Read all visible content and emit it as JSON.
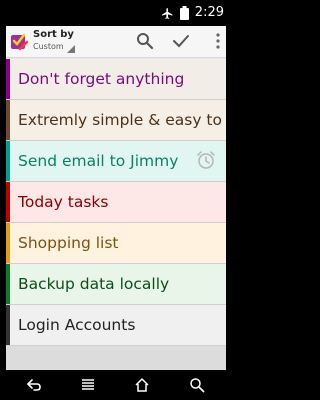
{
  "status_bar": {
    "time": "2:29",
    "icons": [
      "airplane-mode-icon",
      "battery-icon"
    ]
  },
  "action_bar": {
    "sort_title": "Sort by",
    "sort_value": "Custom",
    "actions": [
      "search-icon",
      "check-icon",
      "overflow-menu-icon"
    ]
  },
  "tasks": [
    {
      "label": "Don't forget anything",
      "stripe_color": "#8b008b",
      "bg_color": "#f2ede6",
      "text_color": "#7a0a7a",
      "has_alarm": false
    },
    {
      "label": "Extremly simple & easy to use",
      "stripe_color": "#6b4a2e",
      "bg_color": "#f6efe6",
      "text_color": "#4a3318",
      "has_alarm": false
    },
    {
      "label": "Send email to Jimmy",
      "stripe_color": "#00a38a",
      "bg_color": "#e2f6f1",
      "text_color": "#0a7f6a",
      "has_alarm": true
    },
    {
      "label": "Today tasks",
      "stripe_color": "#c00000",
      "bg_color": "#fde7e7",
      "text_color": "#8a0000",
      "has_alarm": false
    },
    {
      "label": "Shopping list",
      "stripe_color": "#e69a1a",
      "bg_color": "#fff3e0",
      "text_color": "#7a5310",
      "has_alarm": false
    },
    {
      "label": "Backup data locally",
      "stripe_color": "#0f7a2a",
      "bg_color": "#eaf5ea",
      "text_color": "#0a4f1a",
      "has_alarm": false
    },
    {
      "label": "Login Accounts",
      "stripe_color": "#333333",
      "bg_color": "#f0f0f0",
      "text_color": "#222222",
      "has_alarm": false
    }
  ],
  "nav_bar": {
    "buttons": [
      "back-icon",
      "home-list-icon",
      "home-icon",
      "search-icon"
    ]
  }
}
